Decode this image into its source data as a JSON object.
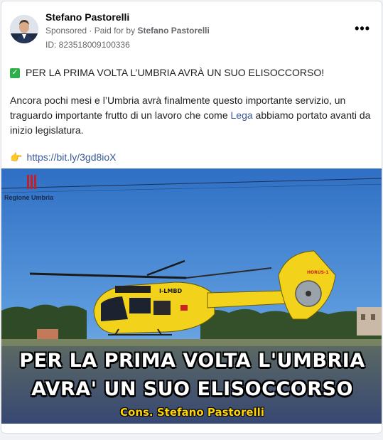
{
  "post": {
    "author": "Stefano Pastorelli",
    "sponsored_label": "Sponsored",
    "paid_for_text": "Paid for by",
    "paid_for_name": "Stefano Pastorelli",
    "id_text": "ID: 823518009100336",
    "more_label": "•••",
    "headline": "PER LA PRIMA VOLTA L’UMBRIA AVRÀ UN SUO ELISOCCORSO!",
    "body_before": "Ancora pochi mesi e l’Umbria avrà finalmente questo importante servizio, un traguardo importante frutto di un lavoro che come ",
    "body_link": "Lega",
    "body_after": " abbiamo portato avanti da inizio legislatura.",
    "url": "https://bit.ly/3gd8ioX"
  },
  "media": {
    "region_label": "Regione Umbria",
    "helicopter_markings": [
      "I-LMBD",
      "HORUS-1"
    ],
    "overlay_line1": "PER LA PRIMA VOLTA L'UMBRIA",
    "overlay_line2": "AVRA' UN SUO ELISOCCORSO",
    "overlay_line3": "Cons. Stefano Pastorelli"
  },
  "colors": {
    "link": "#385898",
    "check": "#2eaf4a",
    "helicopter": "#f2d21a",
    "sky": "#4f8fd6"
  },
  "icons": {
    "headline_check": "check-mark-icon",
    "link_pointer": "pointing-hand-icon"
  }
}
